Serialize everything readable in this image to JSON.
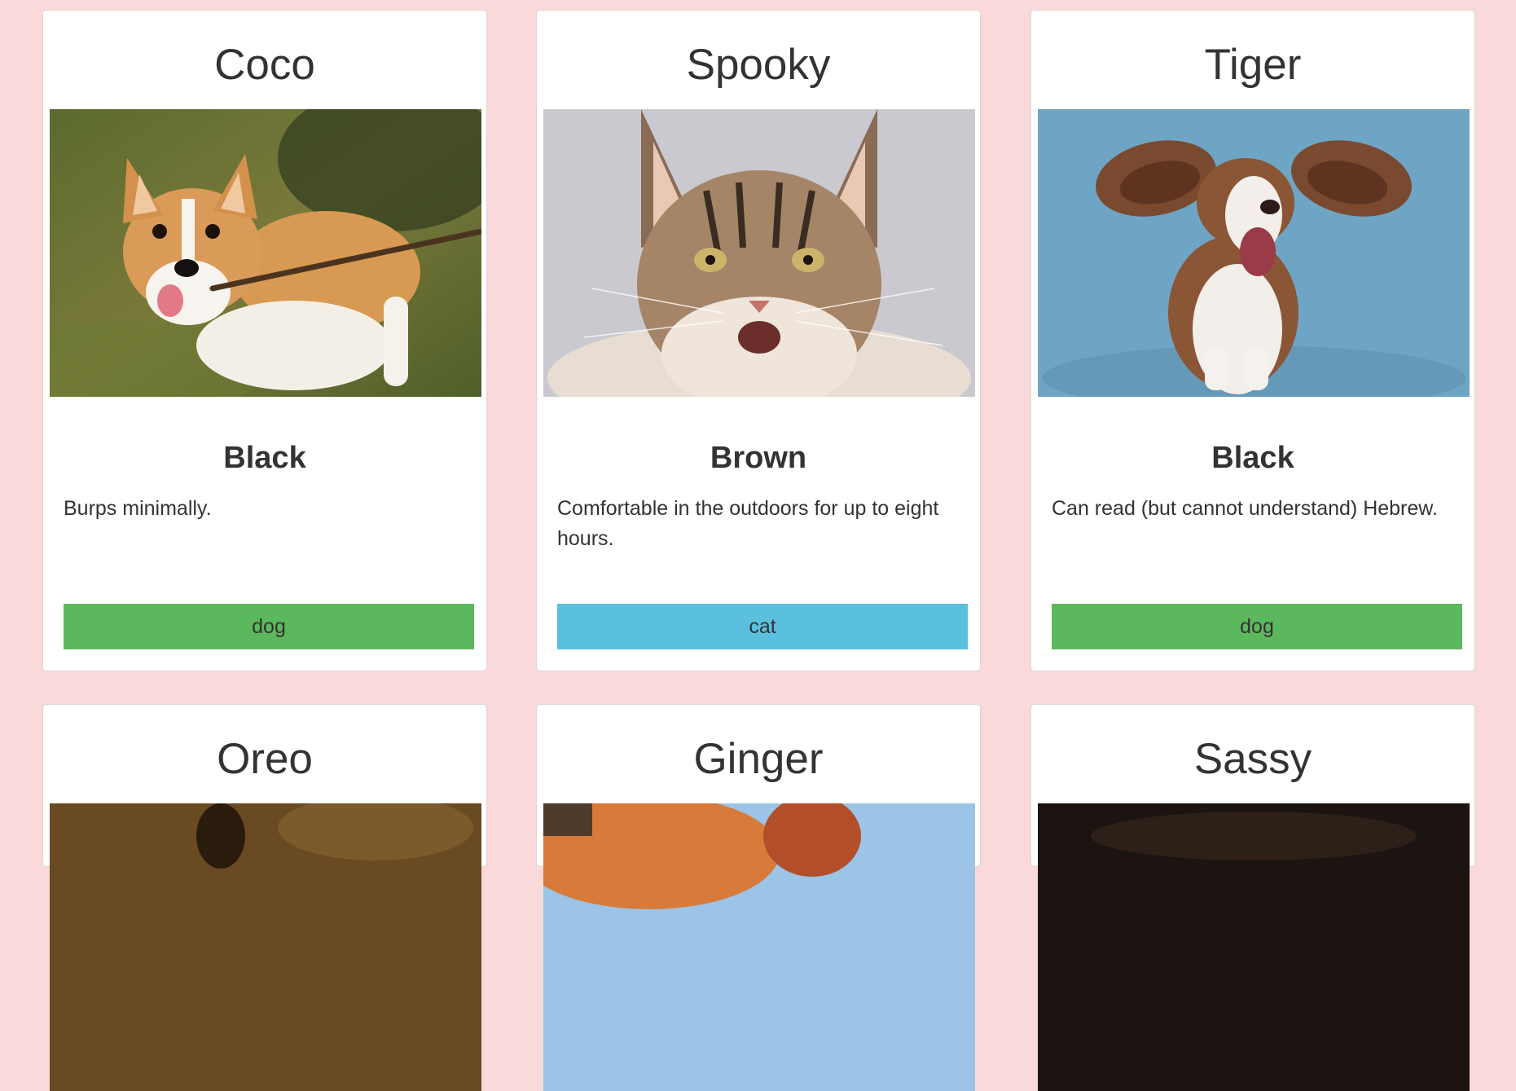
{
  "colors": {
    "page_background": "#f9d9d9",
    "dog_tag": "#5cb85c",
    "cat_tag": "#5bc0de"
  },
  "pets": [
    {
      "name": "Coco",
      "color": "Black",
      "description": "Burps minimally.",
      "type": "dog",
      "photo_icon": "corgi-photo"
    },
    {
      "name": "Spooky",
      "color": "Brown",
      "description": "Comfortable in the outdoors for up to eight hours.",
      "type": "cat",
      "photo_icon": "maine-coon-photo"
    },
    {
      "name": "Tiger",
      "color": "Black",
      "description": "Can read (but cannot understand) Hebrew.",
      "type": "dog",
      "photo_icon": "basset-hound-photo"
    },
    {
      "name": "Oreo",
      "photo_icon": "oreo-photo"
    },
    {
      "name": "Ginger",
      "photo_icon": "ginger-photo"
    },
    {
      "name": "Sassy",
      "photo_icon": "sassy-photo"
    }
  ]
}
